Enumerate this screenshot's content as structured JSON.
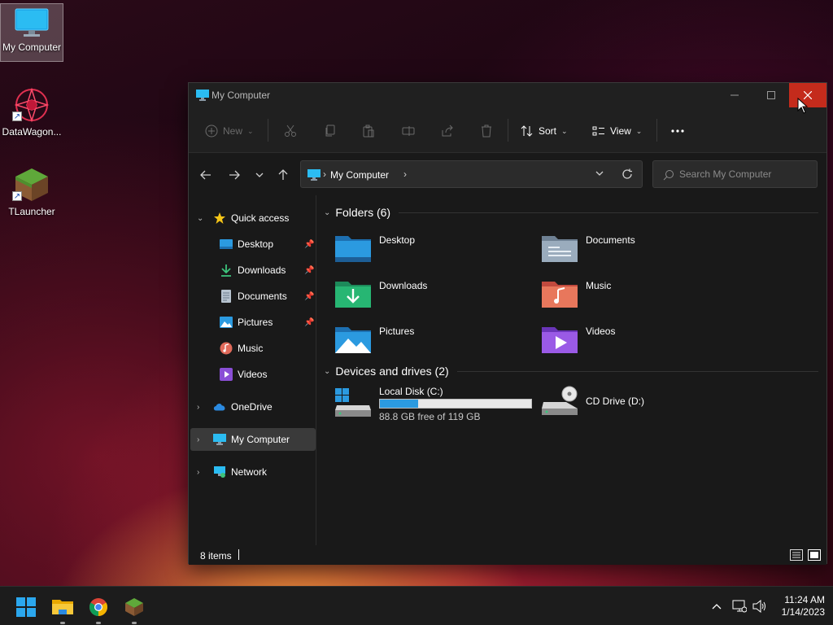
{
  "desktop": {
    "icons": [
      {
        "label": "My Computer",
        "icon": "monitor-icon"
      },
      {
        "label": "DataWagon...",
        "icon": "datawagon-icon"
      },
      {
        "label": "TLauncher",
        "icon": "minecraft-grass-block-icon"
      }
    ]
  },
  "window": {
    "title": "My Computer",
    "controls": {
      "minimize": "minimize-icon",
      "maximize": "maximize-icon",
      "close": "close-icon"
    }
  },
  "toolbar": {
    "new_label": "New",
    "sort_label": "Sort",
    "view_label": "View",
    "more": "more-icon",
    "actions": [
      "cut-icon",
      "copy-icon",
      "paste-icon",
      "rename-icon",
      "share-icon",
      "delete-icon"
    ]
  },
  "navbar": {
    "breadcrumb": "My Computer",
    "search_placeholder": "Search My Computer"
  },
  "sidebar": {
    "quick_access": "Quick access",
    "pinned": [
      {
        "label": "Desktop",
        "pinned": true
      },
      {
        "label": "Downloads",
        "pinned": true
      },
      {
        "label": "Documents",
        "pinned": true
      },
      {
        "label": "Pictures",
        "pinned": true
      },
      {
        "label": "Music",
        "pinned": false
      },
      {
        "label": "Videos",
        "pinned": false
      }
    ],
    "onedrive": "OneDrive",
    "my_computer": "My Computer",
    "network": "Network"
  },
  "content": {
    "folders_heading": "Folders (6)",
    "folders": [
      "Desktop",
      "Documents",
      "Downloads",
      "Music",
      "Pictures",
      "Videos"
    ],
    "drives_heading": "Devices and drives (2)",
    "drives": [
      {
        "label": "Local Disk (C:)",
        "free_text": "88.8 GB free of 119 GB",
        "used_fraction": 0.254
      },
      {
        "label": "CD Drive (D:)"
      }
    ]
  },
  "status": {
    "item_count": "8 items"
  },
  "taskbar": {
    "apps": [
      "start-icon",
      "file-explorer-icon",
      "chrome-icon",
      "minecraft-icon"
    ],
    "time": "11:24 AM",
    "date": "1/14/2023"
  },
  "colors": {
    "accent": "#2b9ae0",
    "close_hover": "#c42b1c",
    "window_bg": "#191919"
  }
}
